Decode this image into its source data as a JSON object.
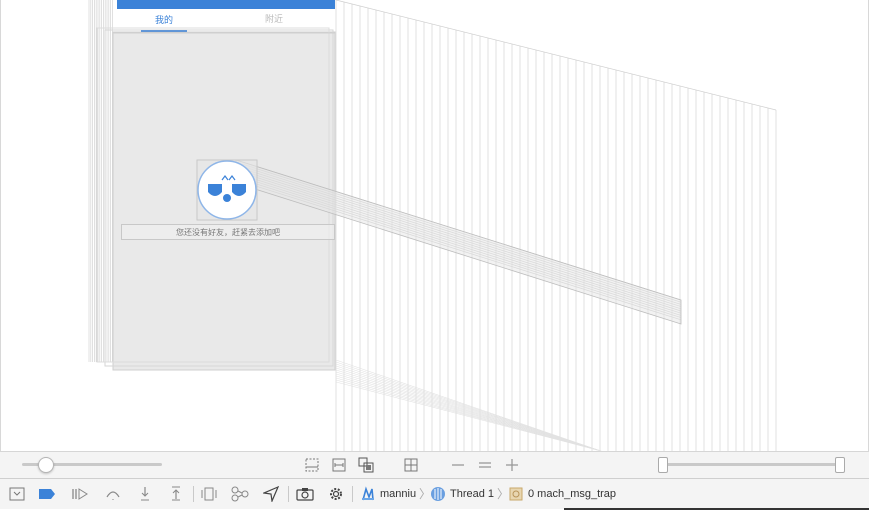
{
  "canvas": {
    "tabs": [
      "我的",
      "附近"
    ],
    "empty_message": "您还没有好友，赶紧去添加吧"
  },
  "debug_bar": {
    "zoom_slider_value": 0.1,
    "range_slider": [
      0,
      1
    ],
    "icons": [
      "clipping-icon",
      "fit-width-icon",
      "show-frames-icon",
      "grid-icon",
      "zoom-out-icon",
      "zoom-reset-icon",
      "zoom-in-icon"
    ]
  },
  "jump_bar": {
    "project": "manniu",
    "thread": "Thread 1",
    "frame": "0 mach_msg_trap"
  },
  "colors": {
    "accent": "#3b82d8",
    "bar_bg": "#f4f4f4",
    "layer_line": "#cfcfcf"
  }
}
